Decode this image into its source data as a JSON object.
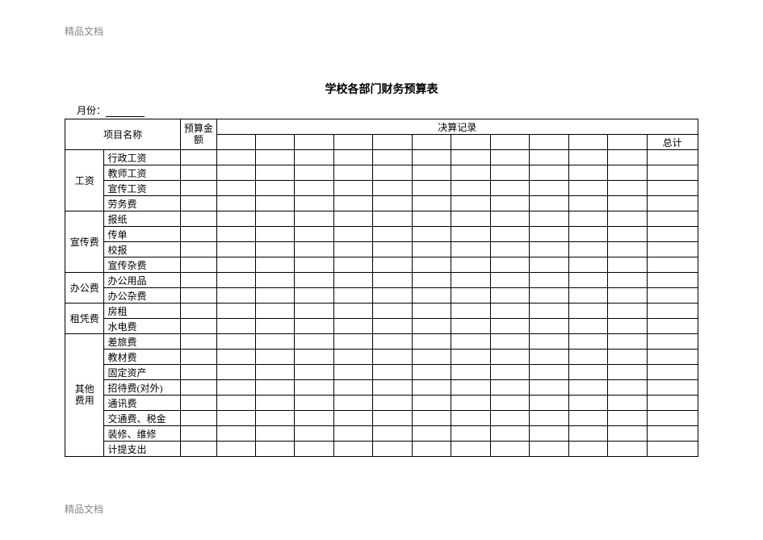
{
  "watermark": "精品文档",
  "title": "学校各部门财务预算表",
  "month_label": "月份：",
  "headers": {
    "project_name": "项目名称",
    "budget_amount_l1": "预算金",
    "budget_amount_l2": "额",
    "settlement_record": "决算记录",
    "total": "总计"
  },
  "categories": [
    {
      "name": "工资",
      "items": [
        "行政工资",
        "教师工资",
        "宣传工资",
        "劳务费"
      ]
    },
    {
      "name": "宣传费",
      "items": [
        "报纸",
        "传单",
        "校报",
        "宣传杂费"
      ]
    },
    {
      "name": "办公费",
      "items": [
        "办公用品",
        "办公杂费"
      ]
    },
    {
      "name": "租凭费",
      "items": [
        "房租",
        "水电费"
      ]
    },
    {
      "name_l1": "其他",
      "name_l2": "费用",
      "items": [
        "差旅费",
        "教材费",
        "固定资产",
        "招待费(对外)",
        "通讯费",
        "交通费、税金",
        "装修、维修",
        "计提支出"
      ]
    }
  ]
}
